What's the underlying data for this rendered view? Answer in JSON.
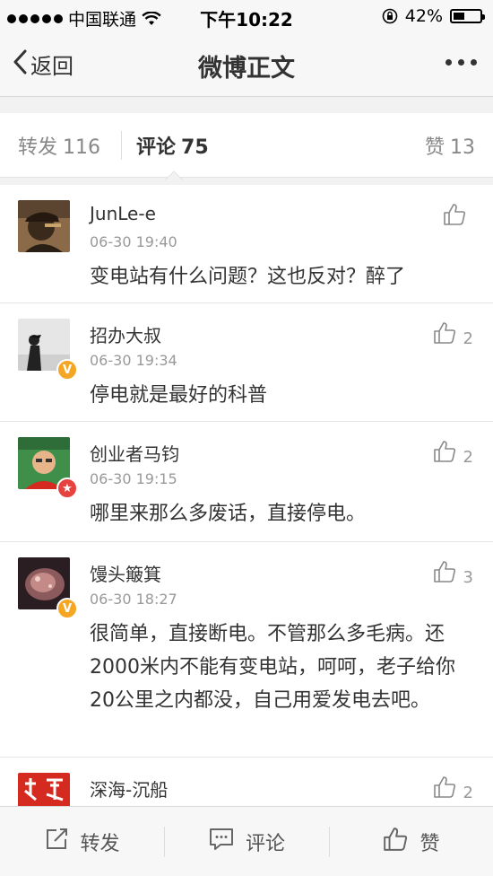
{
  "status_bar": {
    "carrier": "中国联通",
    "time": "下午10:22",
    "battery": "42%"
  },
  "nav": {
    "back_label": "返回",
    "title": "微博正文"
  },
  "tabs": {
    "repost": {
      "label": "转发",
      "count": "116"
    },
    "comment": {
      "label": "评论",
      "count": "75"
    },
    "like": {
      "label": "赞",
      "count": "13"
    }
  },
  "comments": [
    {
      "username": "JunLe-e",
      "time": "06-30 19:40",
      "text": "变电站有什么问题？这也反对？醉了",
      "likes": "",
      "badge": "none"
    },
    {
      "username": "招办大叔",
      "time": "06-30 19:34",
      "text": "停电就是最好的科普",
      "likes": "2",
      "badge": "v"
    },
    {
      "username": "创业者马钧",
      "time": "06-30 19:15",
      "text": "哪里来那么多废话，直接停电。",
      "likes": "2",
      "badge": "star"
    },
    {
      "username": "馒头簸箕",
      "time": "06-30 18:27",
      "text": "很简单，直接断电。不管那么多毛病。还2000米内不能有变电站，呵呵，老子给你20公里之内都没，自己用爱发电去吧。",
      "likes": "3",
      "badge": "v"
    },
    {
      "username": "深海-沉船",
      "time": "",
      "text": "",
      "likes": "2",
      "badge": "none"
    }
  ],
  "bottom_bar": {
    "repost_label": "转发",
    "comment_label": "评论",
    "like_label": "赞"
  },
  "colors": {
    "badge_v": "#f5a623",
    "badge_star": "#e64340",
    "avatar_red": "#d42a20"
  }
}
